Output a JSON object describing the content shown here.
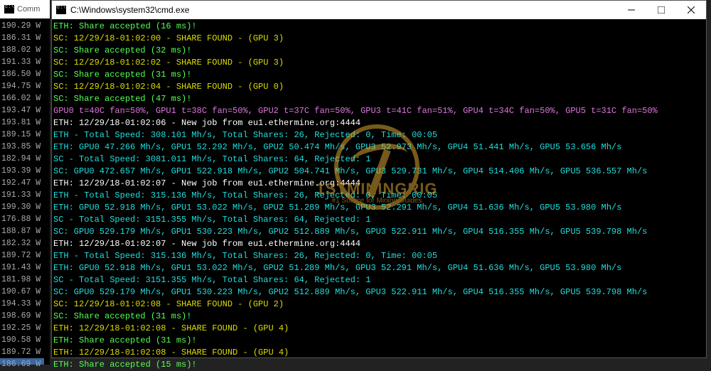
{
  "back_window": {
    "title": "Comm"
  },
  "front_window": {
    "title": "C:\\Windows\\system32\\cmd.exe"
  },
  "left_col": [
    "190.29 W",
    "186.31 W",
    "188.02 W",
    "191.33 W",
    "186.50 W",
    "194.75 W",
    "166.02 W",
    "193.47 W",
    "193.81 W",
    "189.15 W",
    "193.85 W",
    "182.94 W",
    "193.39 W",
    "192.47 W",
    "191.33 W",
    "199.30 W",
    "176.88 W",
    "188.87 W",
    "182.32 W",
    "189.72 W",
    "191.43 W",
    "181.98 W",
    "190.67 W",
    "194.33 W",
    "198.69 W",
    "192.25 W",
    "190.58 W",
    "189.72 W",
    "186.69 W"
  ],
  "lines": [
    {
      "cls": "c-green",
      "t": "ETH: Share accepted (16 ms)!"
    },
    {
      "cls": "c-yellow",
      "t": "SC: 12/29/18-01:02:00 - SHARE FOUND - (GPU 3)"
    },
    {
      "cls": "c-green",
      "t": "SC: Share accepted (32 ms)!"
    },
    {
      "cls": "c-yellow",
      "t": "SC: 12/29/18-01:02:02 - SHARE FOUND - (GPU 3)"
    },
    {
      "cls": "c-green",
      "t": "SC: Share accepted (31 ms)!"
    },
    {
      "cls": "c-yellow",
      "t": "SC: 12/29/18-01:02:04 - SHARE FOUND - (GPU 0)"
    },
    {
      "cls": "c-green",
      "t": "SC: Share accepted (47 ms)!"
    },
    {
      "cls": "c-magenta",
      "t": "GPU0 t=40C fan=50%, GPU1 t=38C fan=50%, GPU2 t=37C fan=50%, GPU3 t=41C fan=51%, GPU4 t=34C fan=50%, GPU5 t=31C fan=50%"
    },
    {
      "cls": "c-white",
      "t": "ETH: 12/29/18-01:02:06 - New job from eu1.ethermine.org:4444"
    },
    {
      "cls": "c-teal",
      "t": "ETH - Total Speed: 308.101 Mh/s, Total Shares: 26, Rejected: 0, Time: 00:05"
    },
    {
      "cls": "c-teal",
      "t": "ETH: GPU0 47.266 Mh/s, GPU1 52.292 Mh/s, GPU2 50.474 Mh/s, GPU3 52.973 Mh/s, GPU4 51.441 Mh/s, GPU5 53.656 Mh/s"
    },
    {
      "cls": "c-teal",
      "t": " SC - Total Speed: 3081.011 Mh/s, Total Shares: 64, Rejected: 1"
    },
    {
      "cls": "c-teal",
      "t": " SC: GPU0 472.657 Mh/s, GPU1 522.918 Mh/s, GPU2 504.741 Mh/s, GPU3 529.731 Mh/s, GPU4 514.406 Mh/s, GPU5 536.557 Mh/s"
    },
    {
      "cls": "c-white",
      "t": "ETH: 12/29/18-01:02:07 - New job from eu1.ethermine.org:4444"
    },
    {
      "cls": "c-teal",
      "t": "ETH - Total Speed: 315.136 Mh/s, Total Shares: 26, Rejected: 0, Time: 00:05"
    },
    {
      "cls": "c-teal",
      "t": "ETH: GPU0 52.918 Mh/s, GPU1 53.022 Mh/s, GPU2 51.289 Mh/s, GPU3 52.291 Mh/s, GPU4 51.636 Mh/s, GPU5 53.980 Mh/s"
    },
    {
      "cls": "c-teal",
      "t": " SC - Total Speed: 3151.355 Mh/s, Total Shares: 64, Rejected: 1"
    },
    {
      "cls": "c-teal",
      "t": " SC: GPU0 529.179 Mh/s, GPU1 530.223 Mh/s, GPU2 512.889 Mh/s, GPU3 522.911 Mh/s, GPU4 516.355 Mh/s, GPU5 539.798 Mh/s"
    },
    {
      "cls": "c-white",
      "t": "ETH: 12/29/18-01:02:07 - New job from eu1.ethermine.org:4444"
    },
    {
      "cls": "c-teal",
      "t": "ETH - Total Speed: 315.136 Mh/s, Total Shares: 26, Rejected: 0, Time: 00:05"
    },
    {
      "cls": "c-teal",
      "t": "ETH: GPU0 52.918 Mh/s, GPU1 53.022 Mh/s, GPU2 51.289 Mh/s, GPU3 52.291 Mh/s, GPU4 51.636 Mh/s, GPU5 53.980 Mh/s"
    },
    {
      "cls": "c-teal",
      "t": " SC - Total Speed: 3151.355 Mh/s, Total Shares: 64, Rejected: 1"
    },
    {
      "cls": "c-teal",
      "t": " SC: GPU0 529.179 Mh/s, GPU1 530.223 Mh/s, GPU2 512.889 Mh/s, GPU3 522.911 Mh/s, GPU4 516.355 Mh/s, GPU5 539.798 Mh/s"
    },
    {
      "cls": "c-yellow",
      "t": "SC: 12/29/18-01:02:08 - SHARE FOUND - (GPU 2)"
    },
    {
      "cls": "c-green",
      "t": "SC: Share accepted (31 ms)!"
    },
    {
      "cls": "c-yellow",
      "t": "ETH: 12/29/18-01:02:08 - SHARE FOUND - (GPU 4)"
    },
    {
      "cls": "c-green",
      "t": "ETH: Share accepted (31 ms)!"
    },
    {
      "cls": "c-yellow",
      "t": "ETH: 12/29/18-01:02:08 - SHARE FOUND - (GPU 4)"
    },
    {
      "cls": "c-green",
      "t": "ETH: Share accepted (15 ms)!"
    }
  ],
  "watermark": {
    "big": "1STMININGRIG",
    "small": "#1 Source for Mining Guides"
  }
}
